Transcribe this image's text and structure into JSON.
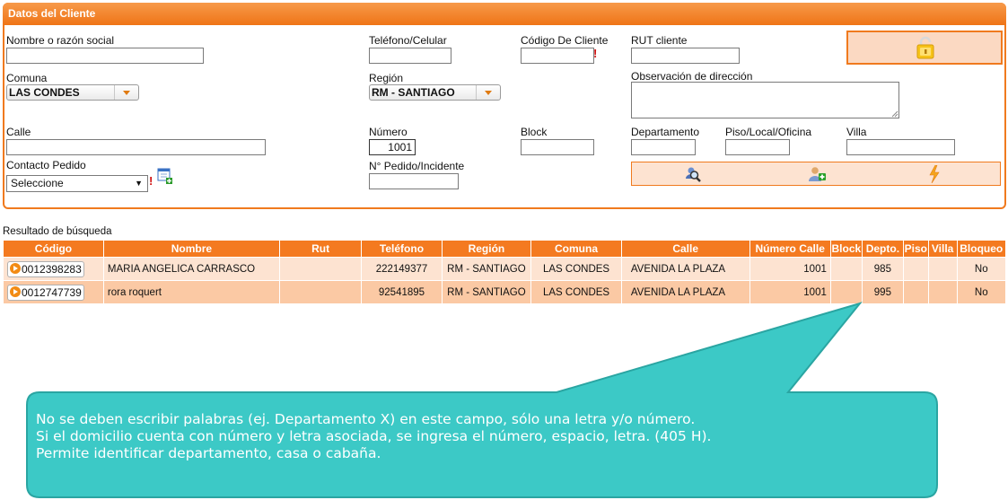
{
  "panel": {
    "title": "Datos del Cliente"
  },
  "form": {
    "nombre_label": "Nombre o razón social",
    "nombre_value": "",
    "telefono_label": "Teléfono/Celular",
    "telefono_value": "",
    "codigo_label": "Código De Cliente",
    "codigo_value": "",
    "rut_label": "RUT cliente",
    "rut_value": "",
    "comuna_label": "Comuna",
    "comuna_value": "LAS CONDES",
    "region_label": "Región",
    "region_value": "RM - SANTIAGO",
    "observacion_label": "Observación de dirección",
    "observacion_value": "",
    "calle_label": "Calle",
    "calle_value": "",
    "numero_label": "Número",
    "numero_value": "1001",
    "block_label": "Block",
    "block_value": "",
    "departamento_label": "Departamento",
    "departamento_value": "",
    "piso_label": "Piso/Local/Oficina",
    "piso_value": "",
    "villa_label": "Villa",
    "villa_value": "",
    "contacto_label": "Contacto Pedido",
    "contacto_value": "Seleccione",
    "pedido_label": "N° Pedido/Incidente",
    "pedido_value": "",
    "required_mark": "!"
  },
  "icons": {
    "lock": "unlock-icon",
    "search": "search-user-icon",
    "add_user": "add-user-icon",
    "lightning": "lightning-icon",
    "calendar_add": "calendar-add-icon"
  },
  "results": {
    "title": "Resultado de búsqueda",
    "columns": [
      "Código",
      "Nombre",
      "Rut",
      "Teléfono",
      "Región",
      "Comuna",
      "Calle",
      "Número Calle",
      "Block",
      "Depto.",
      "Piso",
      "Villa",
      "Bloqueo"
    ],
    "rows": [
      [
        "0012398283",
        "MARIA ANGELICA CARRASCO",
        "",
        "222149377",
        "RM - SANTIAGO",
        "LAS CONDES",
        "AVENIDA LA PLAZA",
        "1001",
        "",
        "985",
        "",
        "",
        "No"
      ],
      [
        "0012747739",
        "rora roquert",
        "",
        "92541895",
        "RM - SANTIAGO",
        "LAS CONDES",
        "AVENIDA LA PLAZA",
        "1001",
        "",
        "995",
        "",
        "",
        "No"
      ]
    ]
  },
  "callout": {
    "lines": [
      "No se deben escribir palabras (ej. Departamento X) en este campo, sólo una letra y/o número.",
      "Si el domicilio cuenta con número y letra asociada, se ingresa el número, espacio, letra. (405 H).",
      "Permite identificar departamento, casa o cabaña."
    ]
  },
  "colors": {
    "accent": "#f07a1e",
    "header_row": "#f47a20",
    "row_light": "#fde3d1",
    "row_dark": "#fbc9a4",
    "callout_fill": "#3cc9c6"
  }
}
